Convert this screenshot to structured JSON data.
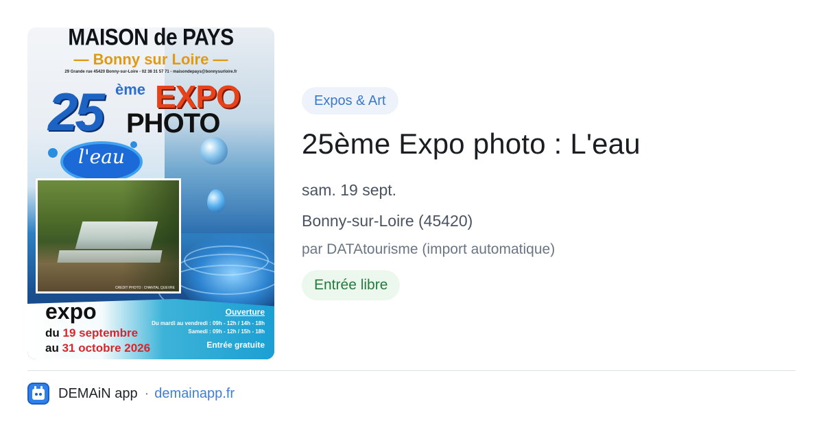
{
  "poster": {
    "maison": "MAISON de PAYS",
    "bonny": "— Bonny sur Loire —",
    "address": "29 Grande rue 45420 Bonny-sur-Loire - 02 38 31 57 71 - maisondepays@bonnysurloire.fr",
    "number": "25",
    "eme": "ème",
    "expo": "EXPO",
    "photo": "PHOTO",
    "theme": "l'eau",
    "credit": "CREDIT PHOTO : CHANTAL QUEVRE",
    "expo_word": "expo",
    "du_prefix": "du ",
    "du_date": "19 septembre",
    "au_prefix": "au ",
    "au_date": "31 octobre 2026",
    "ouverture": "Ouverture",
    "hours_weekdays": "Du mardi au vendredi : 09h - 12h / 14h - 18h",
    "hours_saturday": "Samedi : 09h - 12h / 15h - 18h",
    "entree_gratuite": "Entrée gratuite"
  },
  "event": {
    "category": "Expos & Art",
    "title": "25ème Expo photo : L'eau",
    "date": "sam. 19 sept.",
    "location": "Bonny-sur-Loire (45420)",
    "source": "par DATAtourisme (import automatique)",
    "price": "Entrée libre"
  },
  "footer": {
    "app_icon": "calendar-app-icon",
    "app_name": "DEMAiN app",
    "separator": "·",
    "url": "demainapp.fr"
  },
  "colors": {
    "category_badge_bg": "#eef3fb",
    "category_badge_text": "#3a78c9",
    "price_badge_bg": "#ecf7ee",
    "price_badge_text": "#247a3b",
    "link": "#3d7fd3"
  }
}
